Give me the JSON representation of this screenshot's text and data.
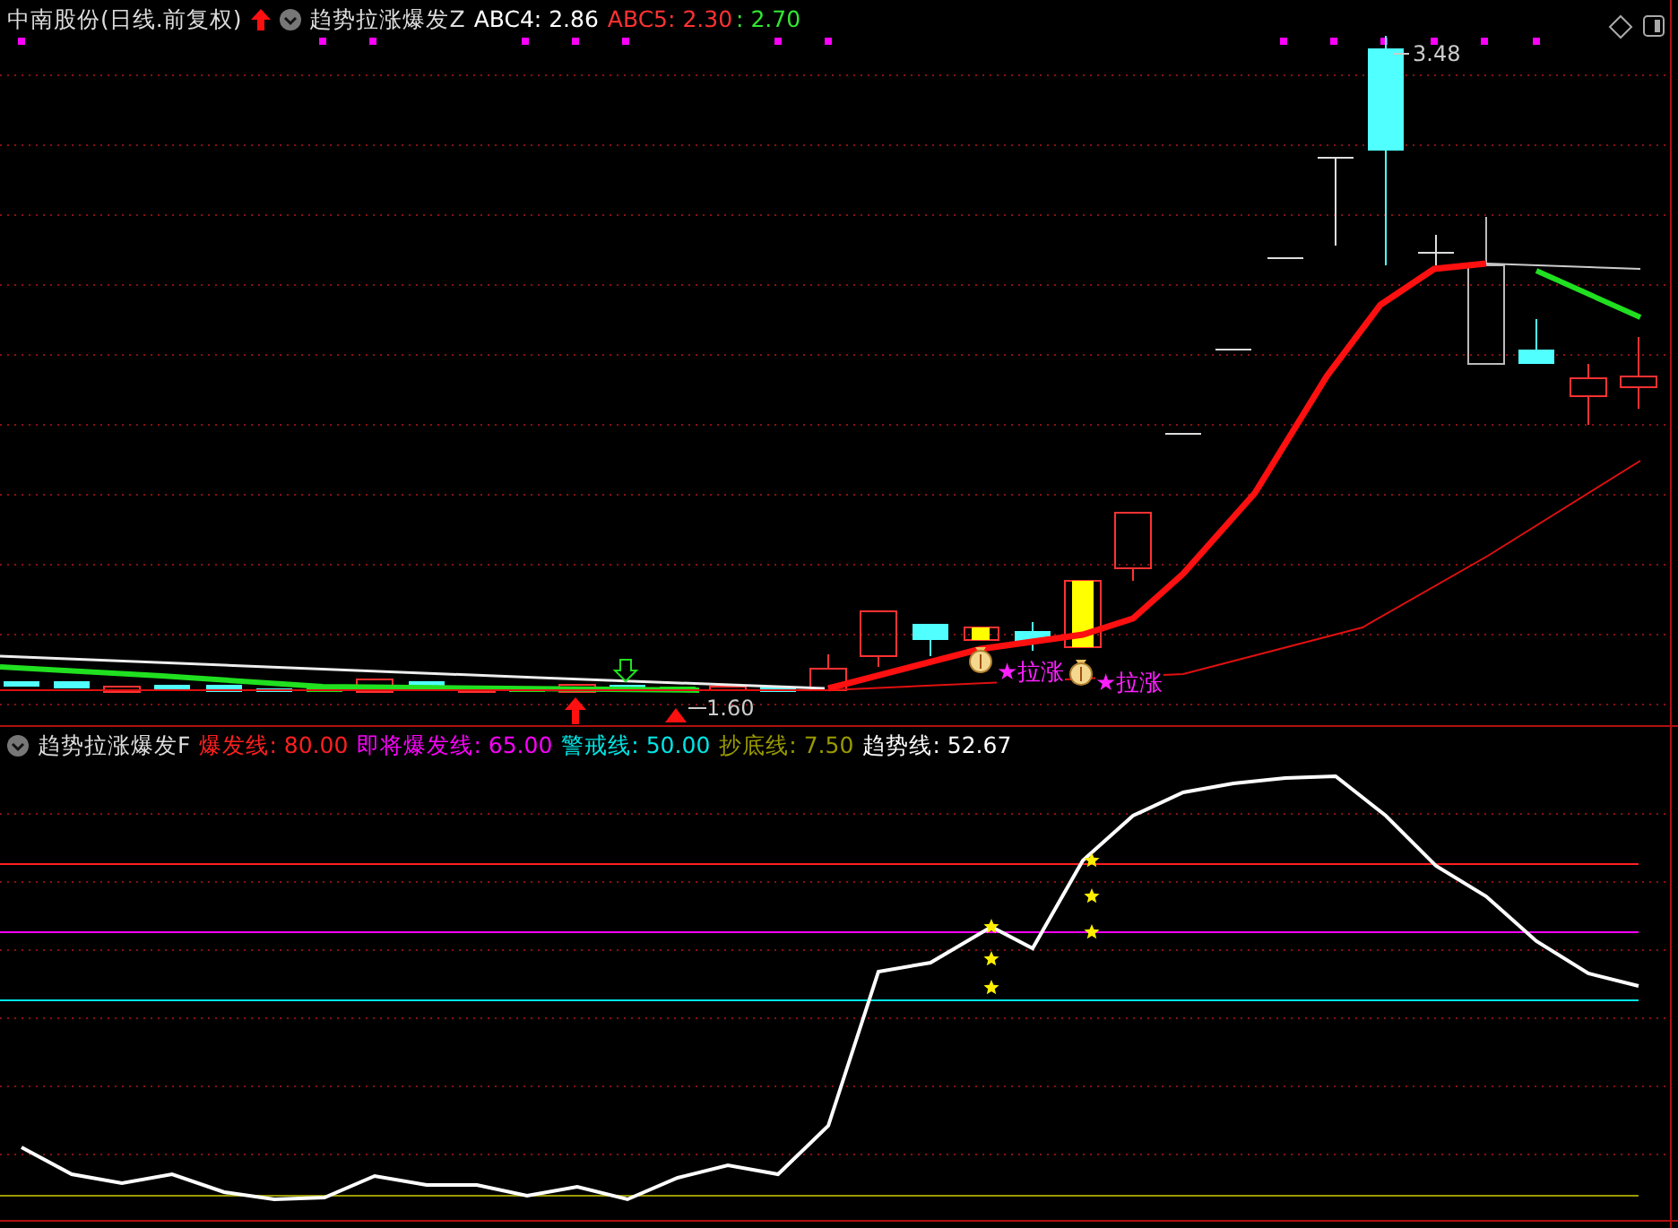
{
  "title_bar": {
    "stock": "中南股份(日线.前复权)",
    "indicator": "趋势拉涨爆发Z",
    "values": [
      {
        "text": "ABC4: 2.86",
        "color": "#ffffff"
      },
      {
        "text": "ABC5: 2.30",
        "color": "#ff3232"
      },
      {
        "text": ": 2.70",
        "color": "#32e632"
      }
    ]
  },
  "price_chart": {
    "high_label": "3.48",
    "low_label": "1.60",
    "signals": [
      {
        "text": "★拉涨"
      },
      {
        "text": "★拉涨"
      }
    ]
  },
  "indicator_panel": {
    "name": "趋势拉涨爆发F",
    "lines": [
      {
        "text": "爆发线: 80.00",
        "color": "#ff2020"
      },
      {
        "text": "即将爆发线: 65.00",
        "color": "#ff00ff"
      },
      {
        "text": "警戒线: 50.00",
        "color": "#00e6e6"
      },
      {
        "text": "抄底线: 7.50",
        "color": "#9a9a00"
      },
      {
        "text": "趋势线: 52.67",
        "color": "#ffffff"
      }
    ]
  }
}
